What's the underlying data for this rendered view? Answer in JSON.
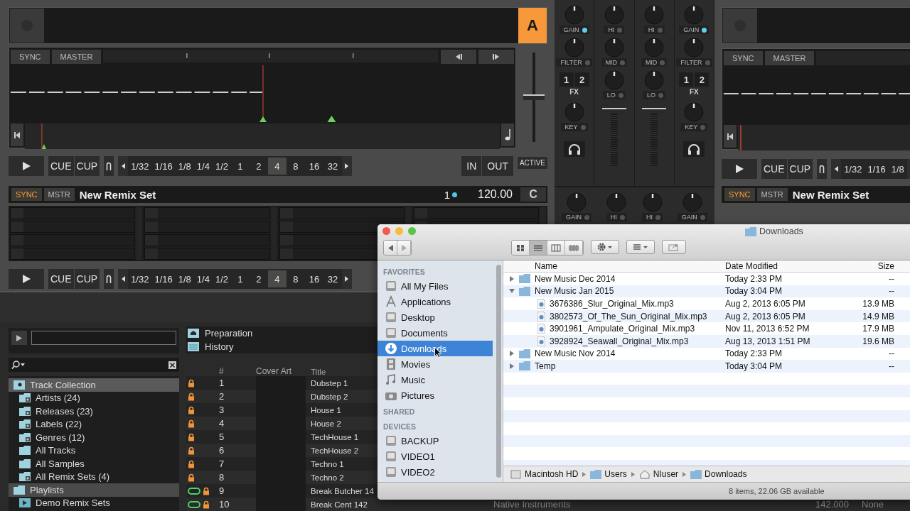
{
  "deck_a": {
    "letter": "A",
    "sync": "SYNC",
    "sync_on": false,
    "master": "MASTER",
    "tempo": {
      "level": 0.5
    },
    "transport": {
      "cue": "CUE",
      "cup": "CUP",
      "loop_sizes": [
        {
          "label": "1/32",
          "selected": false
        },
        {
          "label": "1/16",
          "selected": false
        },
        {
          "label": "1/8",
          "selected": false
        },
        {
          "label": "1/4",
          "selected": false
        },
        {
          "label": "1/2",
          "selected": false
        },
        {
          "label": "1",
          "selected": false
        },
        {
          "label": "2",
          "selected": false
        },
        {
          "label": "4",
          "selected": true
        },
        {
          "label": "8",
          "selected": false
        },
        {
          "label": "16",
          "selected": false
        },
        {
          "label": "32",
          "selected": false
        }
      ],
      "in": "IN",
      "out": "OUT",
      "active": "ACTIVE"
    }
  },
  "deck_c": {
    "sync": "SYNC",
    "sync_on": true,
    "master": "MSTR",
    "title": "New Remix Set",
    "beat": "1",
    "tempo": "120.00",
    "letter": "C",
    "transport": {
      "cue": "CUE",
      "cup": "CUP",
      "loop_sizes": [
        {
          "label": "1/32",
          "selected": false
        },
        {
          "label": "1/16",
          "selected": false
        },
        {
          "label": "1/8",
          "selected": false
        },
        {
          "label": "1/4",
          "selected": false
        },
        {
          "label": "1/2",
          "selected": false
        },
        {
          "label": "1",
          "selected": false
        },
        {
          "label": "2",
          "selected": false
        },
        {
          "label": "4",
          "selected": true
        },
        {
          "label": "8",
          "selected": false
        },
        {
          "label": "16",
          "selected": false
        },
        {
          "label": "32",
          "selected": false
        }
      ]
    }
  },
  "mixer": {
    "columns": [
      [
        {
          "kind": "knob",
          "label": "GAIN",
          "on": true
        },
        {
          "kind": "knob",
          "label": "FILTER",
          "on": false
        },
        {
          "kind": "fx",
          "buttons": [
            "1",
            "2"
          ],
          "label": "FX"
        },
        {
          "kind": "knob",
          "label": "KEY",
          "on": false
        },
        {
          "kind": "headphones"
        }
      ],
      [
        {
          "kind": "knob",
          "label": "HI",
          "on": false
        },
        {
          "kind": "knob",
          "label": "MID",
          "on": false
        },
        {
          "kind": "knob",
          "label": "LO",
          "on": false
        },
        {
          "kind": "fader",
          "level": 1
        }
      ],
      [
        {
          "kind": "knob",
          "label": "HI",
          "on": false
        },
        {
          "kind": "knob",
          "label": "MID",
          "on": false
        },
        {
          "kind": "knob",
          "label": "LO",
          "on": false
        },
        {
          "kind": "fader",
          "level": 1
        }
      ],
      [
        {
          "kind": "knob",
          "label": "GAIN",
          "on": true
        },
        {
          "kind": "knob",
          "label": "FILTER",
          "on": false
        },
        {
          "kind": "fx",
          "buttons": [
            "1",
            "2"
          ],
          "label": "FX"
        },
        {
          "kind": "knob",
          "label": "KEY",
          "on": false
        },
        {
          "kind": "headphones"
        }
      ]
    ],
    "lower": [
      {
        "label": "GAIN",
        "on": false
      },
      {
        "label": "HI",
        "on": false
      },
      {
        "label": "HI",
        "on": false
      },
      {
        "label": "GAIN",
        "on": false
      }
    ]
  },
  "deck_b": {
    "sync": "SYNC",
    "sync_on": false,
    "master": "MASTER",
    "transport": {
      "cue": "CUE",
      "cup": "CUP",
      "loop_sizes": [
        {
          "label": "1/32",
          "selected": false
        },
        {
          "label": "1/16",
          "selected": false
        },
        {
          "label": "1/8",
          "selected": false
        }
      ]
    }
  },
  "deck_d": {
    "sync": "SYNC",
    "sync_on": true,
    "master": "MSTR",
    "title": "New Remix Set"
  },
  "browser": {
    "favorites": [
      {
        "label": "Preparation",
        "kind": "home"
      },
      {
        "label": "History",
        "kind": "list"
      }
    ],
    "tree": [
      {
        "label": "Track Collection",
        "selected": true,
        "kind": "collection",
        "children": [
          {
            "label": "Artists (24)",
            "selected": false,
            "kind": "group"
          },
          {
            "label": "Releases (23)",
            "selected": false,
            "kind": "group"
          },
          {
            "label": "Labels (22)",
            "selected": false,
            "kind": "group"
          },
          {
            "label": "Genres (12)",
            "selected": false,
            "kind": "group"
          },
          {
            "label": "All Tracks",
            "selected": false,
            "kind": "folder"
          },
          {
            "label": "All Samples",
            "selected": false,
            "kind": "folder"
          },
          {
            "label": "All Remix Sets (4)",
            "selected": false,
            "kind": "group"
          }
        ]
      },
      {
        "label": "Playlists",
        "selected": false,
        "kind": "open",
        "children": [
          {
            "label": "Demo Remix Sets",
            "selected": false,
            "kind": "playlist"
          }
        ]
      }
    ],
    "columns": [
      "#",
      "Cover Art",
      "Title"
    ],
    "rows": [
      {
        "num": "1",
        "title": "Dubstep 1",
        "locked": true,
        "looped": false
      },
      {
        "num": "2",
        "title": "Dubstep 2",
        "locked": true,
        "looped": false
      },
      {
        "num": "3",
        "title": "House 1",
        "locked": true,
        "looped": false
      },
      {
        "num": "4",
        "title": "House 2",
        "locked": true,
        "looped": false
      },
      {
        "num": "5",
        "title": "TechHouse 1",
        "locked": true,
        "looped": false
      },
      {
        "num": "6",
        "title": "TechHouse 2",
        "locked": true,
        "looped": false
      },
      {
        "num": "7",
        "title": "Techno 1",
        "locked": true,
        "looped": false
      },
      {
        "num": "8",
        "title": "Techno 2",
        "locked": true,
        "looped": false
      },
      {
        "num": "9",
        "title": "Break Butcher 14",
        "locked": true,
        "looped": true
      },
      {
        "num": "10",
        "title": "Break Cent 142",
        "locked": true,
        "looped": true,
        "artist": "Native Instruments",
        "bpm": "142.000",
        "key": "None"
      }
    ]
  },
  "finder": {
    "title": "Downloads",
    "view_modes": [
      {
        "kind": "icons",
        "selected": false
      },
      {
        "kind": "list",
        "selected": true
      },
      {
        "kind": "columns",
        "selected": false
      },
      {
        "kind": "coverflow",
        "selected": false
      }
    ],
    "sidebar": [
      {
        "heading": "FAVORITES",
        "items": [
          {
            "label": "All My Files",
            "kind": "files",
            "selected": false
          },
          {
            "label": "Applications",
            "kind": "apps",
            "selected": false
          },
          {
            "label": "Desktop",
            "kind": "desktop",
            "selected": false
          },
          {
            "label": "Documents",
            "kind": "documents",
            "selected": false
          },
          {
            "label": "Downloads",
            "kind": "downloads",
            "selected": true
          },
          {
            "label": "Movies",
            "kind": "movies",
            "selected": false
          },
          {
            "label": "Music",
            "kind": "music",
            "selected": false
          },
          {
            "label": "Pictures",
            "kind": "pictures",
            "selected": false
          }
        ]
      },
      {
        "heading": "SHARED"
      },
      {
        "heading": "DEVICES",
        "items": [
          {
            "label": "BACKUP",
            "kind": "drive",
            "selected": false
          },
          {
            "label": "VIDEO1",
            "kind": "drive",
            "selected": false
          },
          {
            "label": "VIDEO2",
            "kind": "drive",
            "selected": false
          }
        ]
      }
    ],
    "columns": [
      "Name",
      "Date Modified",
      "Size"
    ],
    "rows": [
      {
        "kind": "folder",
        "name": "New Music Dec 2014",
        "date": "Today 2:33 PM",
        "size": "--",
        "expanded": false
      },
      {
        "kind": "folder",
        "name": "New Music Jan 2015",
        "date": "Today 3:04 PM",
        "size": "--",
        "expanded": true,
        "children": [
          {
            "kind": "file",
            "name": "3676386_Slur_Original_Mix.mp3",
            "date": "Aug 2, 2013 6:05 PM",
            "size": "13.9 MB"
          },
          {
            "kind": "file",
            "name": "3802573_Of_The_Sun_Original_Mix.mp3",
            "date": "Aug 2, 2013 6:05 PM",
            "size": "14.9 MB"
          },
          {
            "kind": "file",
            "name": "3901961_Ampulate_Original_Mix.mp3",
            "date": "Nov 11, 2013 6:52 PM",
            "size": "17.9 MB"
          },
          {
            "kind": "file",
            "name": "3928924_Seawall_Original_Mix.mp3",
            "date": "Aug 13, 2013 1:51 PM",
            "size": "19.6 MB"
          }
        ]
      },
      {
        "kind": "folder",
        "name": "New Music Nov 2014",
        "date": "Today 2:33 PM",
        "size": "--",
        "expanded": false
      },
      {
        "kind": "folder",
        "name": "Temp",
        "date": "Today 3:04 PM",
        "size": "--",
        "expanded": false
      }
    ],
    "path": [
      {
        "label": "Macintosh HD",
        "kind": "disk"
      },
      {
        "label": "Users",
        "kind": "folder"
      },
      {
        "label": "NIuser",
        "kind": "home"
      },
      {
        "label": "Downloads",
        "kind": "folder"
      }
    ],
    "status": "8 items, 22.06 GB available"
  }
}
